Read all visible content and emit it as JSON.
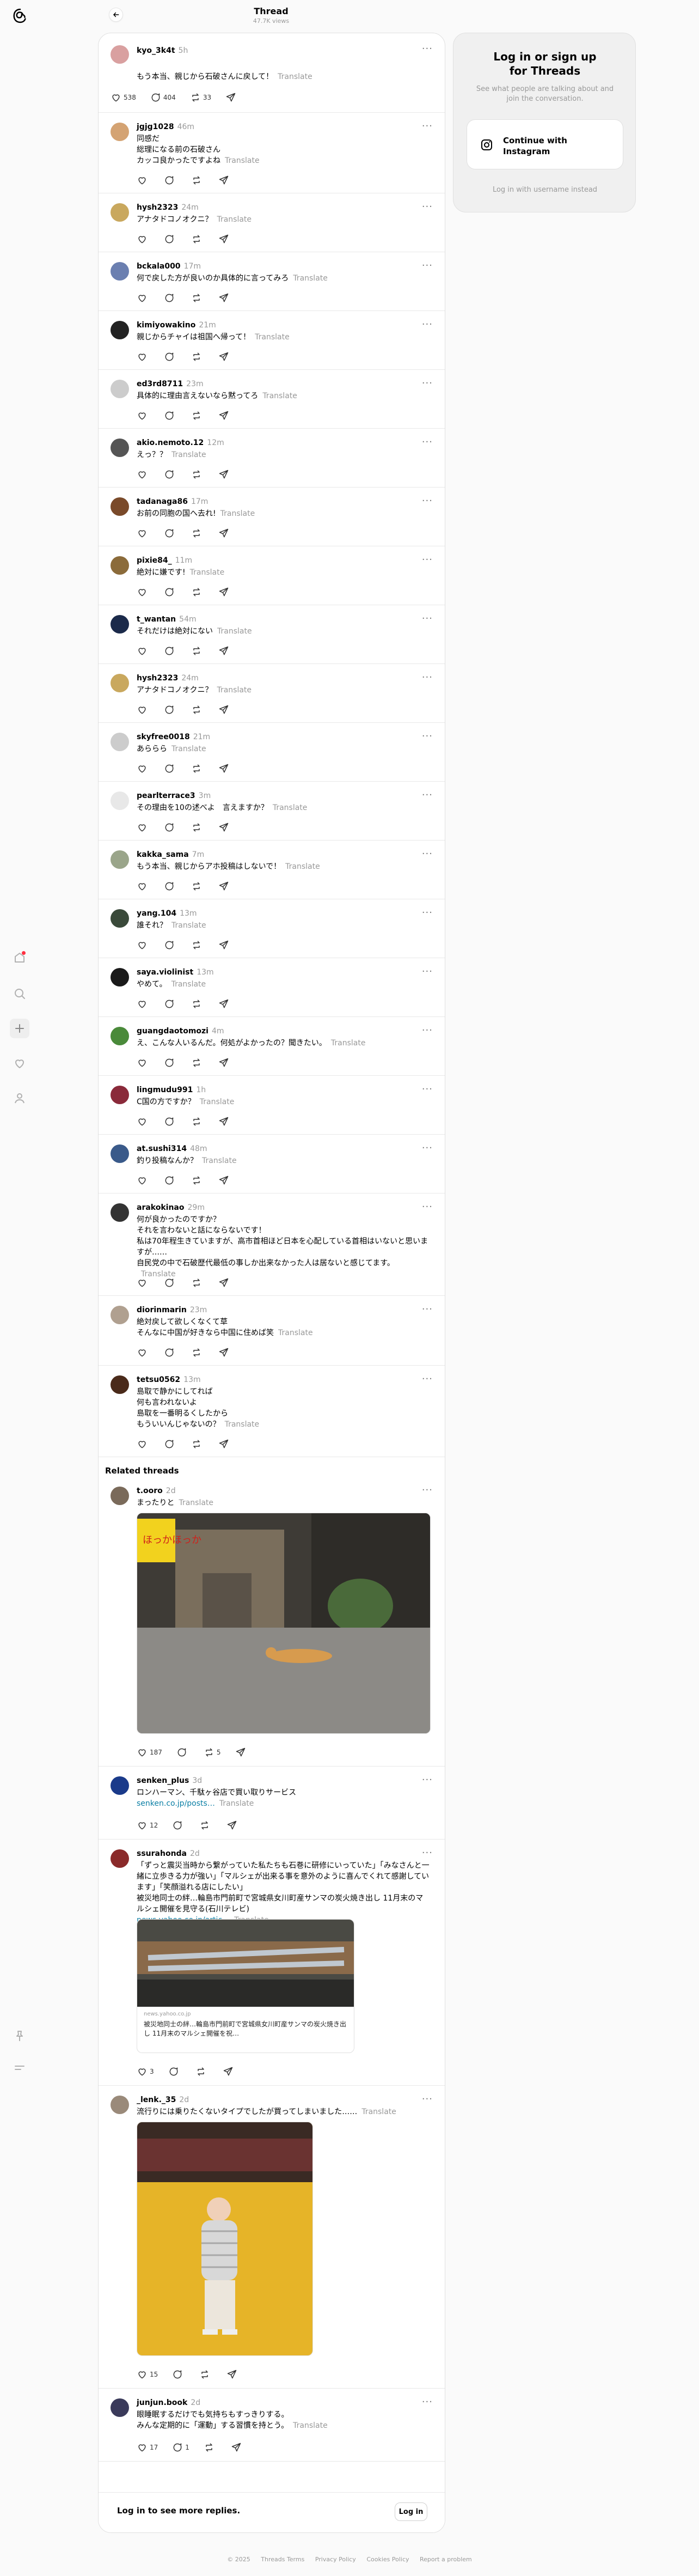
{
  "header": {
    "title": "Thread",
    "subtitle": "47.7K views"
  },
  "main_post": {
    "user": "kyo_3k4t",
    "time": "5h",
    "text": "もう本当、親じから石破さんに戻して！",
    "translate": "Translate",
    "likes": "538",
    "replies": "404",
    "reposts": "33"
  },
  "replies": [
    {
      "user": "jgjg1028",
      "time": "46m",
      "text": "同感だ\n総理になる前の石破さん\nカッコ良かったですよね",
      "translate": "Translate",
      "color": "#d4a373"
    },
    {
      "user": "hysh2323",
      "time": "24m",
      "text": "アナタドコノオクニ？",
      "translate": "Translate",
      "color": "#c9a85e"
    },
    {
      "user": "bckala000",
      "time": "17m",
      "text": "何で戻した方が良いのか具体的に言ってみろ",
      "translate": "Translate",
      "color": "#6b7fb0"
    },
    {
      "user": "kimiyowakino",
      "time": "21m",
      "text": "親じからチャイは祖国へ帰って！",
      "translate": "Translate",
      "color": "#222222"
    },
    {
      "user": "ed3rd8711",
      "time": "23m",
      "text": "具体的に理由言えないなら黙ってろ",
      "translate": "Translate",
      "color": "#cccccc"
    },
    {
      "user": "akio.nemoto.12",
      "time": "12m",
      "text": "えっ？？",
      "translate": "Translate",
      "color": "#555555"
    },
    {
      "user": "tadanaga86",
      "time": "17m",
      "text": "お前の同胞の国へ去れ!",
      "translate": "Translate",
      "color": "#7a4a2a"
    },
    {
      "user": "pixie84_",
      "time": "11m",
      "text": "絶対に嫌です!",
      "translate": "Translate",
      "color": "#8b6b3a"
    },
    {
      "user": "t_wantan",
      "time": "54m",
      "text": "それだけは絶対にない",
      "translate": "Translate",
      "color": "#1b2a4a"
    },
    {
      "user": "hysh2323",
      "time": "24m",
      "text": "アナタドコノオクニ？",
      "translate": "Translate",
      "color": "#c9a85e"
    },
    {
      "user": "skyfree0018",
      "time": "21m",
      "text": "あららら",
      "translate": "Translate",
      "color": "#cccccc"
    },
    {
      "user": "pearlterrace3",
      "time": "3m",
      "text": "その理由を10の述べよ　言えますか？",
      "translate": "Translate",
      "color": "#e8e8e8"
    },
    {
      "user": "kakka_sama",
      "time": "7m",
      "text": "もう本当、親じからアホ投稿はしないで！",
      "translate": "Translate",
      "color": "#9aa58a"
    },
    {
      "user": "yang.104",
      "time": "13m",
      "text": "誰それ？",
      "translate": "Translate",
      "color": "#3a4a3a"
    },
    {
      "user": "saya.violinist",
      "time": "13m",
      "text": "やめて。",
      "translate": "Translate",
      "color": "#1a1a1a"
    },
    {
      "user": "guangdaotomozi",
      "time": "4m",
      "text": "え、こんな人いるんだ。何処がよかったの？聞きたい。",
      "translate": "Translate",
      "color": "#4a8a3a"
    },
    {
      "user": "lingmudu991",
      "time": "1h",
      "text": "C国の方ですか？",
      "translate": "Translate",
      "color": "#8a2a3a"
    },
    {
      "user": "at.sushi314",
      "time": "48m",
      "text": "釣り投稿なんか？",
      "translate": "Translate",
      "color": "#3a5a8a"
    },
    {
      "user": "arakokinao",
      "time": "29m",
      "text": "何が良かったのですか？\nそれを言わないと話にならないです！\n私は70年程生きていますが、高市首相ほど日本を心配している首相はいないと思いますが……\n自民党の中で石破歴代最低の事しか出来なかった人は居ないと感じてます。",
      "translate": "Translate",
      "color": "#333333"
    },
    {
      "user": "diorinmarin",
      "time": "23m",
      "text": "絶対戻して欲しくなくて草\nそんなに中国が好きなら中国に住めば笑",
      "translate": "Translate",
      "color": "#b0a090"
    },
    {
      "user": "tetsu0562",
      "time": "13m",
      "text": "島取で静かにしてれば\n何も言われないよ\n島取を一番明るくしたから\nもういいんじゃないの？",
      "translate": "Translate",
      "color": "#4a2a1a"
    }
  ],
  "related": {
    "heading": "Related threads",
    "posts": [
      {
        "user": "t.ooro",
        "time": "2d",
        "text": "まったりと",
        "translate": "Translate",
        "likes": "187",
        "replies": "",
        "reposts": "5",
        "color": "#7a6a5a"
      },
      {
        "user": "senken_plus",
        "time": "3d",
        "text": "ロンハーマン、千駄ヶ谷店で買い取りサービス",
        "link": "senken.co.jp/posts…",
        "translate": "Translate",
        "likes": "12",
        "replies": "",
        "reposts": "",
        "color": "#1a3a8a"
      },
      {
        "user": "ssurahonda",
        "time": "2d",
        "text": "「ずっと震災当時から繋がっていた私たちも石巻に研修にいっていた」「みなさんと一緒に立歩きる力が強い」「マルシェが出来る事を意外のように喜んでくれて感謝しています」「笑顔溢れる店にしたい」\n被災地同士の絆…輪島市門前町で宮城県女川町産サンマの炭火焼き出し 11月末のマルシェ開催を見守る(石川テレビ)",
        "link": "news.yahoo.co.jp/artic…",
        "translate": "Translate",
        "likes": "3",
        "replies": "",
        "reposts": "",
        "color": "#8a2a2a",
        "card_domain": "news.yahoo.co.jp",
        "card_title": "被災地同士の絆…輪島市門前町で宮城県女川町産サンマの炭火焼き出し 11月末のマルシェ開催を祝…"
      },
      {
        "user": "_lenk._35",
        "time": "2d",
        "text": "流行りには乗りたくないタイプでしたが買ってしまいました……",
        "translate": "Translate",
        "likes": "15",
        "replies": "",
        "reposts": "",
        "color": "#9a8a7a"
      },
      {
        "user": "junjun.book",
        "time": "2d",
        "text": "眼睡眠するだけでも気持ちもすっきりする。\nみんな定期的に「運動」する習慣を持とう。",
        "translate": "Translate",
        "likes": "17",
        "replies": "1",
        "reposts": "",
        "color": "#3a3a5a"
      }
    ]
  },
  "media": {
    "sign_text": "ほっかほっか"
  },
  "login_bar": {
    "text": "Log in to see more replies.",
    "button": "Log in"
  },
  "side_card": {
    "title": "Log in or sign up\nfor Threads",
    "desc": "See what people are talking about and join the conversation.",
    "ig_button": "Continue with Instagram",
    "alt": "Log in with username instead"
  },
  "footer": [
    "© 2025",
    "Threads Terms",
    "Privacy Policy",
    "Cookies Policy",
    "Report a problem"
  ],
  "icons": [
    "threads-logo-icon",
    "home-icon",
    "search-icon",
    "plus-icon",
    "heart-icon",
    "profile-icon",
    "pin-icon",
    "menu-icon",
    "back-arrow-icon",
    "like-icon",
    "reply-icon",
    "repost-icon",
    "share-icon",
    "instagram-icon"
  ]
}
